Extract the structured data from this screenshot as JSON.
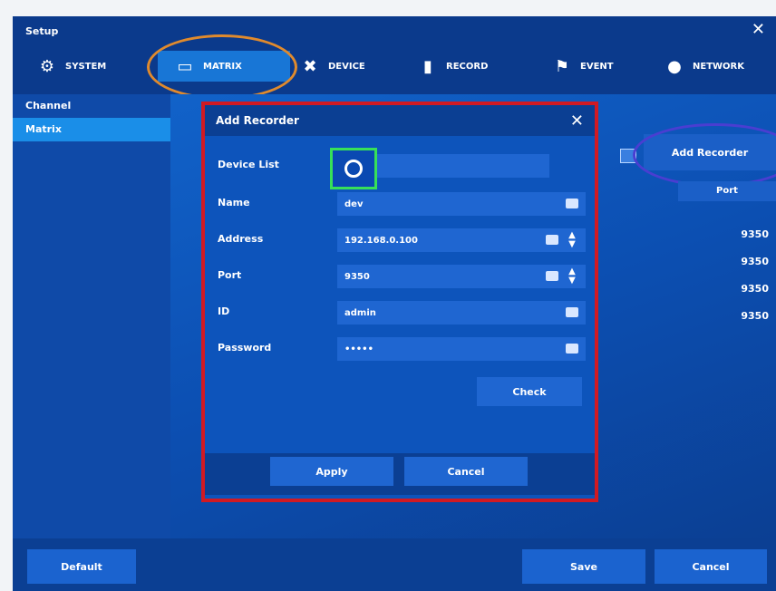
{
  "window": {
    "title": "Setup",
    "close_glyph": "✕"
  },
  "tabs": [
    {
      "label": "SYSTEM",
      "icon": "gear-icon"
    },
    {
      "label": "MATRIX",
      "icon": "matrix-icon"
    },
    {
      "label": "DEVICE",
      "icon": "tools-icon"
    },
    {
      "label": "RECORD",
      "icon": "camera-icon"
    },
    {
      "label": "EVENT",
      "icon": "flag-icon"
    },
    {
      "label": "NETWORK",
      "icon": "globe-icon"
    }
  ],
  "sidebar": {
    "items": [
      {
        "label": "Channel"
      },
      {
        "label": "Matrix"
      }
    ]
  },
  "main": {
    "add_recorder_label": "Add Recorder",
    "column_header": "Port",
    "ports": [
      "9350",
      "9350",
      "9350",
      "9350"
    ]
  },
  "dialog": {
    "title": "Add Recorder",
    "close_glyph": "✕",
    "fields": {
      "device_list": {
        "label": "Device List",
        "value": ""
      },
      "name": {
        "label": "Name",
        "value": "dev"
      },
      "address": {
        "label": "Address",
        "value": "192.168.0.100"
      },
      "port": {
        "label": "Port",
        "value": "9350"
      },
      "id": {
        "label": "ID",
        "value": "admin"
      },
      "password": {
        "label": "Password",
        "value": "•••••"
      }
    },
    "check_label": "Check",
    "apply_label": "Apply",
    "cancel_label": "Cancel"
  },
  "bottom": {
    "default_label": "Default",
    "save_label": "Save",
    "cancel_label": "Cancel"
  },
  "colors": {
    "highlight_orange": "#e08a2d",
    "highlight_red": "#d11a23",
    "highlight_green": "#37e058",
    "highlight_purple": "#4a3ed1"
  }
}
